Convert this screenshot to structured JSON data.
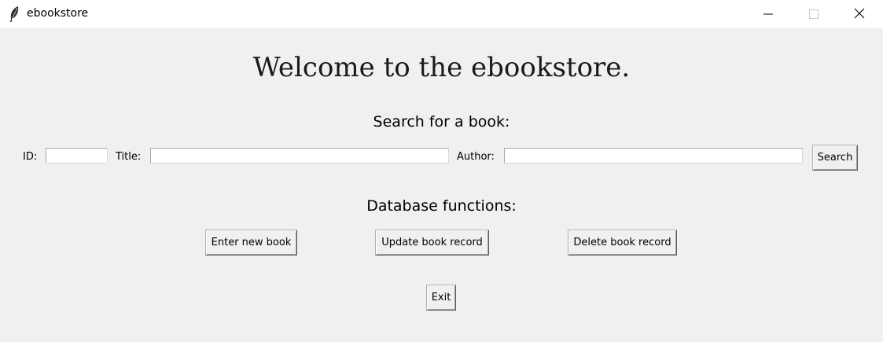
{
  "window": {
    "title": "ebookstore",
    "icons": {
      "app": "feather-icon",
      "minimize": "minimize-icon",
      "maximize": "maximize-icon",
      "close": "close-icon"
    }
  },
  "main": {
    "heading": "Welcome to the ebookstore.",
    "search_section_label": "Search for a book:",
    "search": {
      "id_label": "ID:",
      "id_value": "",
      "title_label": "Title:",
      "title_value": "",
      "author_label": "Author:",
      "author_value": "",
      "search_button": "Search"
    },
    "db_section_label": "Database functions:",
    "db_buttons": {
      "enter": "Enter new book",
      "update": "Update book record",
      "delete": "Delete book record"
    },
    "exit_button": "Exit"
  },
  "colors": {
    "window_bg": "#f0f0f0",
    "titlebar_bg": "#ffffff",
    "entry_bg": "#ffffff"
  }
}
